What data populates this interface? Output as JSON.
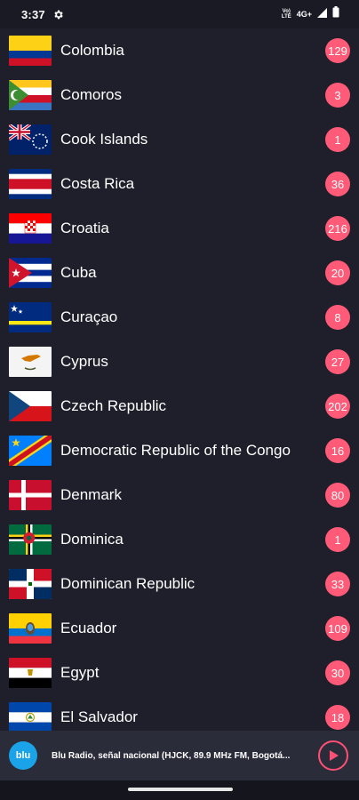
{
  "status_bar": {
    "time": "3:37",
    "volte_line1": "Vo)",
    "volte_line2": "LTE",
    "network": "4G+",
    "icons": [
      "gear-icon",
      "signal-icon",
      "battery-icon"
    ]
  },
  "countries": [
    {
      "name": "Colombia",
      "count": "129",
      "flag": "colombia"
    },
    {
      "name": "Comoros",
      "count": "3",
      "flag": "comoros"
    },
    {
      "name": "Cook Islands",
      "count": "1",
      "flag": "cook"
    },
    {
      "name": "Costa Rica",
      "count": "36",
      "flag": "costarica"
    },
    {
      "name": "Croatia",
      "count": "216",
      "flag": "croatia"
    },
    {
      "name": "Cuba",
      "count": "20",
      "flag": "cuba"
    },
    {
      "name": "Curaçao",
      "count": "8",
      "flag": "curacao"
    },
    {
      "name": "Cyprus",
      "count": "27",
      "flag": "cyprus"
    },
    {
      "name": "Czech Republic",
      "count": "202",
      "flag": "czech"
    },
    {
      "name": "Democratic Republic of the Congo",
      "count": "16",
      "flag": "drc"
    },
    {
      "name": "Denmark",
      "count": "80",
      "flag": "denmark"
    },
    {
      "name": "Dominica",
      "count": "1",
      "flag": "dominica"
    },
    {
      "name": "Dominican Republic",
      "count": "33",
      "flag": "dominicanrep"
    },
    {
      "name": "Ecuador",
      "count": "109",
      "flag": "ecuador"
    },
    {
      "name": "Egypt",
      "count": "30",
      "flag": "egypt"
    },
    {
      "name": "El Salvador",
      "count": "18",
      "flag": "elsalvador"
    }
  ],
  "player": {
    "station_logo_text": "blu",
    "station_title": "Blu Radio, señal nacional (HJCK, 89.9 MHz FM, Bogotá...",
    "play_icon": "play-icon"
  },
  "colors": {
    "background": "#1e1f2b",
    "badge": "#ff5a77",
    "player_bg": "#2b2c3a",
    "accent": "#ff4f74"
  }
}
